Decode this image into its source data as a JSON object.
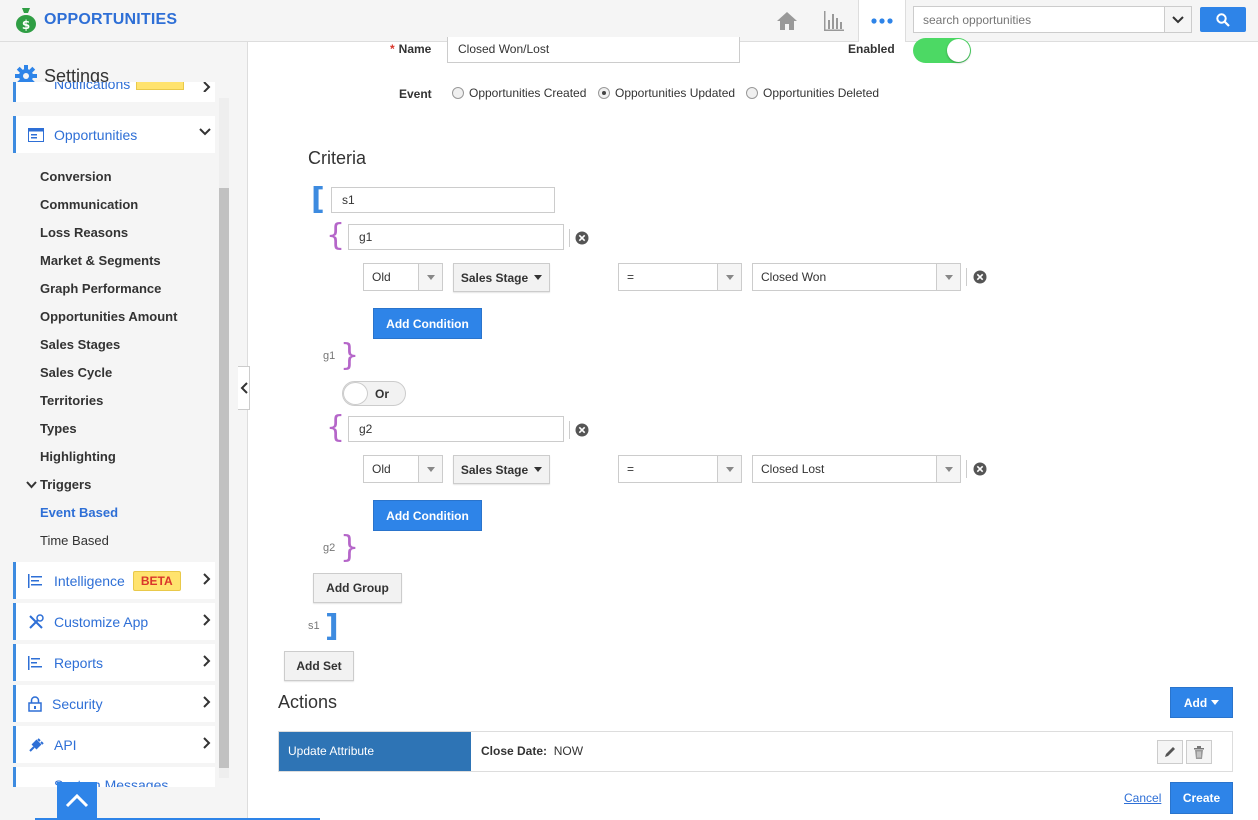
{
  "app": {
    "title": "OPPORTUNITIES"
  },
  "search": {
    "placeholder": "search opportunities"
  },
  "sidebar": {
    "heading": "Settings",
    "partial_item": "Notifications",
    "opportunities_label": "Opportunities",
    "sub_items": [
      "Conversion",
      "Communication",
      "Loss Reasons",
      "Market & Segments",
      "Graph Performance",
      "Opportunities Amount",
      "Sales Stages",
      "Sales Cycle",
      "Territories",
      "Types",
      "Highlighting"
    ],
    "triggers_label": "Triggers",
    "event_based": "Event Based",
    "time_based": "Time Based",
    "intelligence": "Intelligence",
    "beta": "BETA",
    "customize_app": "Customize App",
    "reports": "Reports",
    "security": "Security",
    "api": "API",
    "system_messages": "System Messages"
  },
  "form": {
    "name_label": "Name",
    "name_value": "Closed Won/Lost",
    "enabled_label": "Enabled",
    "enabled": true,
    "event_label": "Event",
    "events": [
      "Opportunities Created",
      "Opportunities Updated",
      "Opportunities Deleted"
    ],
    "selected_event": "Opportunities Updated"
  },
  "criteria": {
    "title": "Criteria",
    "set_name": "s1",
    "set_close_label": "s1",
    "or_label": "Or",
    "groups": [
      {
        "name": "g1",
        "close_label": "g1",
        "age": "Old",
        "field": "Sales Stage",
        "operator": "=",
        "value": "Closed Won",
        "add_condition": "Add Condition"
      },
      {
        "name": "g2",
        "close_label": "g2",
        "age": "Old",
        "field": "Sales Stage",
        "operator": "=",
        "value": "Closed Lost",
        "add_condition": "Add Condition"
      }
    ],
    "add_group": "Add Group",
    "add_set": "Add Set"
  },
  "actions": {
    "title": "Actions",
    "add_label": "Add",
    "row_tag": "Update Attribute",
    "row_field": "Close Date:",
    "row_value": "NOW"
  },
  "footer": {
    "cancel": "Cancel",
    "create": "Create"
  },
  "colors": {
    "accent": "#2e84e8",
    "brand": "#2e6fd6",
    "toggle_on": "#4cd964",
    "group_bracket": "#b566c9",
    "set_bracket": "#3d8be0",
    "beta_bg": "#ffe36e"
  }
}
